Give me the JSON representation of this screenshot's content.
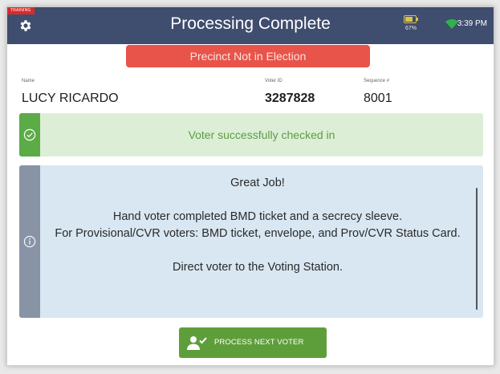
{
  "header": {
    "training_tag": "TRAINING",
    "title": "Processing Complete",
    "battery_percent": "67%",
    "battery_level": 0.67,
    "time": "3:39 PM"
  },
  "alert": {
    "text": "Precinct Not in Election"
  },
  "voter": {
    "name_label": "Name",
    "name": "LUCY RICARDO",
    "id_label": "Voter ID",
    "id": "3287828",
    "sequence_label": "Sequence #",
    "sequence": "8001"
  },
  "success": {
    "text": "Voter successfully checked in"
  },
  "info": {
    "heading": "Great Job!",
    "line1": "Hand voter completed BMD ticket and a secrecy sleeve.",
    "line2": "For Provisional/CVR voters: BMD ticket, envelope, and Prov/CVR Status Card.",
    "line3": "Direct voter to the Voting Station."
  },
  "actions": {
    "process_next": "PROCESS NEXT VOTER"
  },
  "colors": {
    "header_bg": "#3f4d6e",
    "alert_bg": "#e8544a",
    "success_bg": "#dcefd6",
    "success_strip": "#5bab47",
    "info_bg": "#d8e7f2",
    "info_strip": "#8993a6",
    "button_bg": "#5e9e3a"
  },
  "icons": {
    "settings": "gear-icon",
    "battery": "battery-icon",
    "wifi": "wifi-icon",
    "success": "check-circle-icon",
    "info": "info-circle-icon",
    "process": "add-user-check-icon"
  }
}
